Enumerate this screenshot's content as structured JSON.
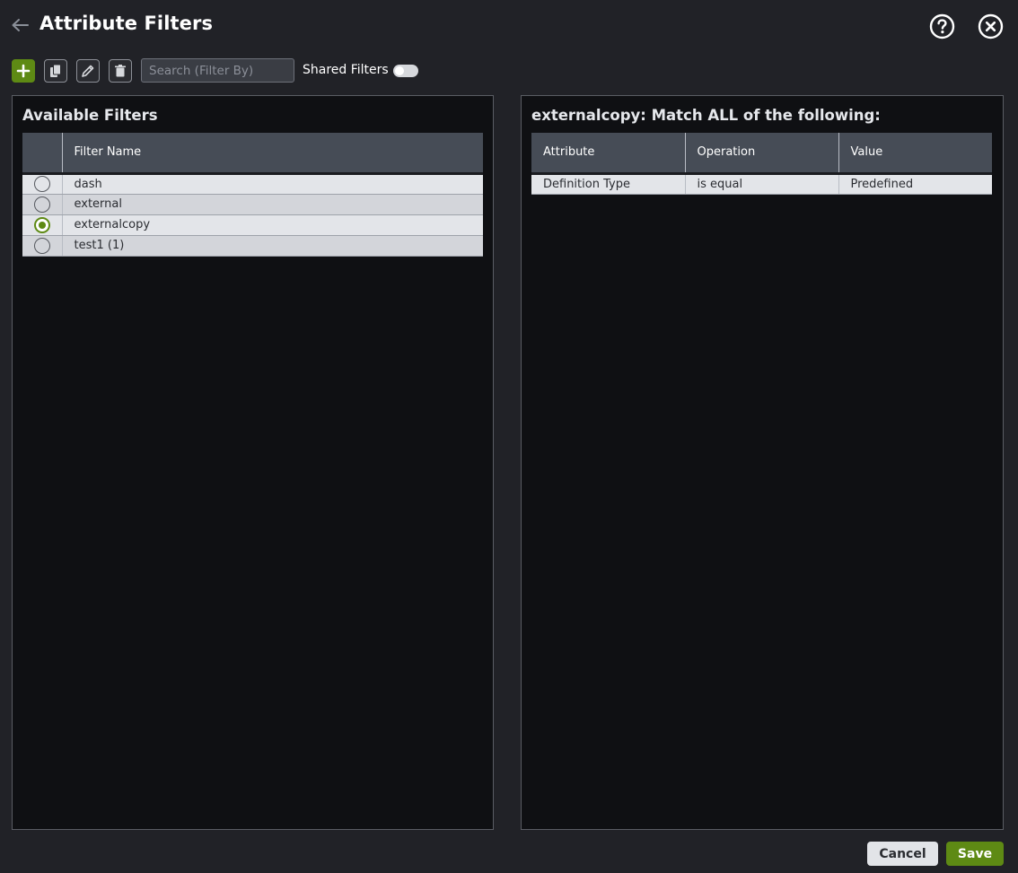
{
  "header": {
    "title": "Attribute Filters",
    "back_icon": "arrow-left-icon",
    "help_icon": "question-circle-icon",
    "close_icon": "close-circle-icon"
  },
  "toolbar": {
    "search_placeholder": "Search (Filter By)",
    "shared_filters_label": "Shared Filters",
    "shared_filters_on": false
  },
  "left_panel": {
    "title": "Available Filters",
    "column_header": "Filter Name",
    "rows": [
      {
        "name": "dash",
        "selected": false
      },
      {
        "name": "external",
        "selected": false
      },
      {
        "name": "externalcopy",
        "selected": true
      },
      {
        "name": "test1 (1)",
        "selected": false
      }
    ]
  },
  "right_panel": {
    "title": "externalcopy: Match ALL of the following:",
    "columns": [
      "Attribute",
      "Operation",
      "Value"
    ],
    "rows": [
      [
        "Definition Type",
        "is equal",
        "Predefined"
      ]
    ]
  },
  "footer": {
    "cancel_label": "Cancel",
    "save_label": "Save"
  },
  "colors": {
    "accent": "#5e8a14",
    "background": "#212227",
    "panel": "#0f1013"
  }
}
